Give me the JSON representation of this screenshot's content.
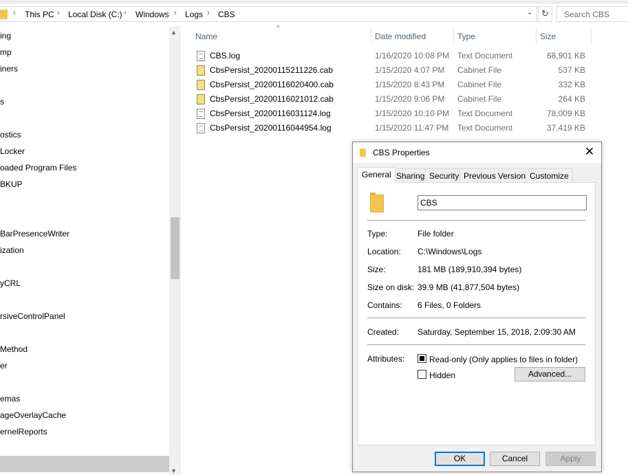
{
  "address": {
    "crumbs": [
      "This PC",
      "Local Disk (C:)",
      "Windows",
      "Logs",
      "CBS"
    ],
    "separator": "›",
    "dropdown_glyph": "⌄",
    "refresh_glyph": "↻",
    "search_placeholder": "Search CBS"
  },
  "nav": {
    "items": [
      "ing",
      "mp",
      "iners",
      "s",
      "",
      "ostics",
      "Locker",
      "oaded Program Files",
      "BKUP",
      "BarPresenceWriter",
      "ization",
      "yCRL",
      "rsiveControlPanel",
      "Method",
      "er",
      "emas",
      "ageOverlayCache",
      "ernelReports"
    ]
  },
  "columns": {
    "name": "Name",
    "date": "Date modified",
    "type": "Type",
    "size": "Size",
    "sort_glyph": "^"
  },
  "files": [
    {
      "name": "CBS.log",
      "date": "1/16/2020 10:08 PM",
      "type": "Text Document",
      "size": "68,901 KB",
      "icon": "log-file-icon"
    },
    {
      "name": "CbsPersist_20200115211226.cab",
      "date": "1/15/2020 4:07 PM",
      "type": "Cabinet File",
      "size": "537 KB",
      "icon": "cab-file-icon"
    },
    {
      "name": "CbsPersist_20200116020400.cab",
      "date": "1/15/2020 8:43 PM",
      "type": "Cabinet File",
      "size": "332 KB",
      "icon": "cab-file-icon"
    },
    {
      "name": "CbsPersist_20200116021012.cab",
      "date": "1/15/2020 9:06 PM",
      "type": "Cabinet File",
      "size": "264 KB",
      "icon": "cab-file-icon"
    },
    {
      "name": "CbsPersist_20200116031124.log",
      "date": "1/15/2020 10:10 PM",
      "type": "Text Document",
      "size": "78,009 KB",
      "icon": "log-file-icon"
    },
    {
      "name": "CbsPersist_20200116044954.log",
      "date": "1/15/2020 11:47 PM",
      "type": "Text Document",
      "size": "37,419 KB",
      "icon": "log-file-icon"
    }
  ],
  "dialog": {
    "title": "CBS Properties",
    "close_glyph": "✕",
    "tabs": [
      "General",
      "Sharing",
      "Security",
      "Previous Versions",
      "Customize"
    ],
    "name_value": "CBS",
    "type_label": "Type:",
    "type_value": "File folder",
    "location_label": "Location:",
    "location_value": "C:\\Windows\\Logs",
    "size_label": "Size:",
    "size_value": "181 MB (189,910,394 bytes)",
    "disk_label": "Size on disk:",
    "disk_value": "39.9 MB (41,877,504 bytes)",
    "contains_label": "Contains:",
    "contains_value": "6 Files, 0 Folders",
    "created_label": "Created:",
    "created_value": "Saturday, September 15, 2018, 2:09:30 AM",
    "attributes_label": "Attributes:",
    "readonly_label": "Read-only (Only applies to files in folder)",
    "readonly_state": "indeterminate",
    "hidden_label": "Hidden",
    "hidden_state": "unchecked",
    "advanced_label": "Advanced...",
    "ok_label": "OK",
    "cancel_label": "Cancel",
    "apply_label": "Apply"
  },
  "colors": {
    "accent": "#0078d7",
    "folder": "#f4c54e",
    "header_text": "#4c607a"
  }
}
